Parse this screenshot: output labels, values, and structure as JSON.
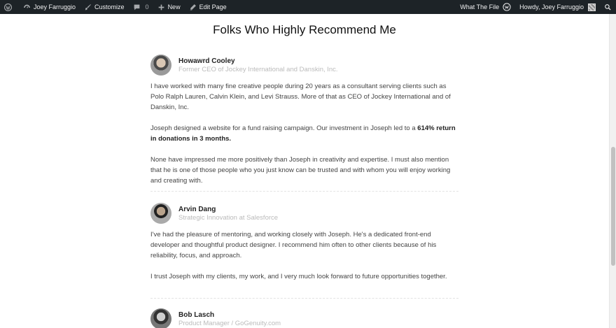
{
  "adminbar": {
    "site_name": "Joey Farruggio",
    "customize": "Customize",
    "comments_count": "0",
    "new_label": "New",
    "edit_page": "Edit Page",
    "what_the_file": "What The File",
    "howdy": "Howdy, Joey Farruggio"
  },
  "page": {
    "title": "Folks Who Highly Recommend Me"
  },
  "testimonials": [
    {
      "name": "Howawrd Cooley",
      "role": "Former CEO of Jockey International and Danskin, Inc.",
      "p1": "I have worked with many fine creative people during 20 years as a consultant serving clients such as Polo Ralph Lauren, Calvin Klein, and Levi Strauss. More of that as CEO of Jockey International and of Danskin, Inc.",
      "p2_lead": "Joseph designed a website for a fund raising campaign. Our investment in Joseph led to a ",
      "p2_bold": "614% return in donations in 3 months.",
      "p3": "None have impressed me more positively than Joseph in creativity and expertise. I must also mention that he is one of those people who you just know can be trusted and with whom you will enjoy working and creating with."
    },
    {
      "name": "Arvin Dang",
      "role": "Strategic Innovation at Salesforce",
      "p1": "I've had the pleasure of mentoring, and working closely with Joseph. He's a dedicated front-end developer and thoughtful product designer. I recommend him often to other clients because of his reliability, focus, and approach.",
      "p2": "I trust Joseph with my clients, my work, and I very much look forward to future opportunities together."
    },
    {
      "name": "Bob Lasch",
      "role": "Product Manager / GoGenuity.com"
    }
  ],
  "icons": {
    "wordpress": "wordpress-icon",
    "site": "dashboard-icon",
    "customize": "brush-icon",
    "comments": "comment-icon",
    "new": "plus-icon",
    "edit": "pencil-icon",
    "what_the_file": "wtf-icon",
    "search": "search-icon"
  }
}
